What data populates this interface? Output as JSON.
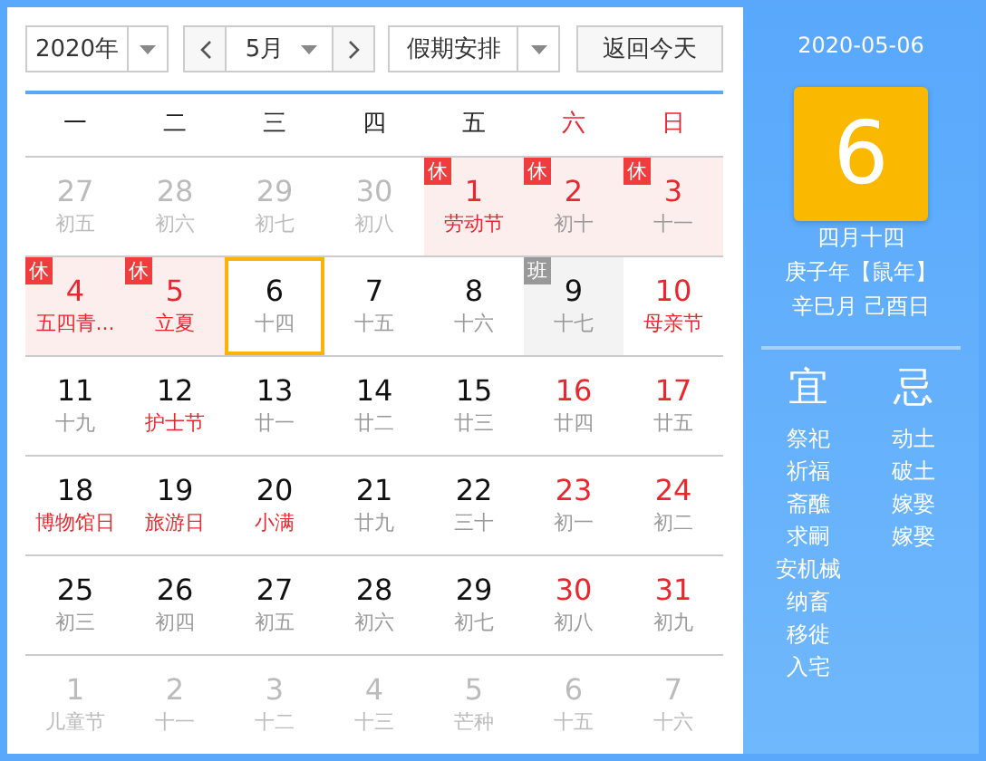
{
  "toolbar": {
    "year": "2020年",
    "month": "5月",
    "holiday": "假期安排",
    "today_button": "返回今天"
  },
  "weekdays": [
    {
      "label": "一",
      "weekend": false
    },
    {
      "label": "二",
      "weekend": false
    },
    {
      "label": "三",
      "weekend": false
    },
    {
      "label": "四",
      "weekend": false
    },
    {
      "label": "五",
      "weekend": false
    },
    {
      "label": "六",
      "weekend": true
    },
    {
      "label": "日",
      "weekend": true
    }
  ],
  "weeks": [
    [
      {
        "day": "27",
        "lunar": "初五",
        "muted": true,
        "red": false,
        "lunar_red": false,
        "selected": false
      },
      {
        "day": "28",
        "lunar": "初六",
        "muted": true,
        "red": false,
        "lunar_red": false,
        "selected": false
      },
      {
        "day": "29",
        "lunar": "初七",
        "muted": true,
        "red": false,
        "lunar_red": false,
        "selected": false
      },
      {
        "day": "30",
        "lunar": "初八",
        "muted": true,
        "red": false,
        "lunar_red": false,
        "selected": false
      },
      {
        "day": "1",
        "lunar": "劳动节",
        "muted": false,
        "red": true,
        "lunar_red": true,
        "selected": false,
        "badge": {
          "kind": "rest",
          "text": "休"
        }
      },
      {
        "day": "2",
        "lunar": "初十",
        "muted": false,
        "red": true,
        "lunar_red": false,
        "selected": false,
        "badge": {
          "kind": "rest",
          "text": "休"
        }
      },
      {
        "day": "3",
        "lunar": "十一",
        "muted": false,
        "red": true,
        "lunar_red": false,
        "selected": false,
        "badge": {
          "kind": "rest",
          "text": "休"
        }
      }
    ],
    [
      {
        "day": "4",
        "lunar": "五四青...",
        "muted": false,
        "red": true,
        "lunar_red": true,
        "selected": false,
        "badge": {
          "kind": "rest",
          "text": "休"
        }
      },
      {
        "day": "5",
        "lunar": "立夏",
        "muted": false,
        "red": true,
        "lunar_red": true,
        "selected": false,
        "badge": {
          "kind": "rest",
          "text": "休"
        }
      },
      {
        "day": "6",
        "lunar": "十四",
        "muted": false,
        "red": false,
        "lunar_red": false,
        "selected": true
      },
      {
        "day": "7",
        "lunar": "十五",
        "muted": false,
        "red": false,
        "lunar_red": false,
        "selected": false
      },
      {
        "day": "8",
        "lunar": "十六",
        "muted": false,
        "red": false,
        "lunar_red": false,
        "selected": false
      },
      {
        "day": "9",
        "lunar": "十七",
        "muted": false,
        "red": false,
        "lunar_red": false,
        "selected": false,
        "badge": {
          "kind": "work",
          "text": "班"
        }
      },
      {
        "day": "10",
        "lunar": "母亲节",
        "muted": false,
        "red": true,
        "lunar_red": true,
        "selected": false
      }
    ],
    [
      {
        "day": "11",
        "lunar": "十九",
        "muted": false,
        "red": false,
        "lunar_red": false,
        "selected": false
      },
      {
        "day": "12",
        "lunar": "护士节",
        "muted": false,
        "red": false,
        "lunar_red": true,
        "selected": false
      },
      {
        "day": "13",
        "lunar": "廿一",
        "muted": false,
        "red": false,
        "lunar_red": false,
        "selected": false
      },
      {
        "day": "14",
        "lunar": "廿二",
        "muted": false,
        "red": false,
        "lunar_red": false,
        "selected": false
      },
      {
        "day": "15",
        "lunar": "廿三",
        "muted": false,
        "red": false,
        "lunar_red": false,
        "selected": false
      },
      {
        "day": "16",
        "lunar": "廿四",
        "muted": false,
        "red": true,
        "lunar_red": false,
        "selected": false
      },
      {
        "day": "17",
        "lunar": "廿五",
        "muted": false,
        "red": true,
        "lunar_red": false,
        "selected": false
      }
    ],
    [
      {
        "day": "18",
        "lunar": "博物馆日",
        "muted": false,
        "red": false,
        "lunar_red": true,
        "selected": false
      },
      {
        "day": "19",
        "lunar": "旅游日",
        "muted": false,
        "red": false,
        "lunar_red": true,
        "selected": false
      },
      {
        "day": "20",
        "lunar": "小满",
        "muted": false,
        "red": false,
        "lunar_red": true,
        "selected": false
      },
      {
        "day": "21",
        "lunar": "廿九",
        "muted": false,
        "red": false,
        "lunar_red": false,
        "selected": false
      },
      {
        "day": "22",
        "lunar": "三十",
        "muted": false,
        "red": false,
        "lunar_red": false,
        "selected": false
      },
      {
        "day": "23",
        "lunar": "初一",
        "muted": false,
        "red": true,
        "lunar_red": false,
        "selected": false
      },
      {
        "day": "24",
        "lunar": "初二",
        "muted": false,
        "red": true,
        "lunar_red": false,
        "selected": false
      }
    ],
    [
      {
        "day": "25",
        "lunar": "初三",
        "muted": false,
        "red": false,
        "lunar_red": false,
        "selected": false
      },
      {
        "day": "26",
        "lunar": "初四",
        "muted": false,
        "red": false,
        "lunar_red": false,
        "selected": false
      },
      {
        "day": "27",
        "lunar": "初五",
        "muted": false,
        "red": false,
        "lunar_red": false,
        "selected": false
      },
      {
        "day": "28",
        "lunar": "初六",
        "muted": false,
        "red": false,
        "lunar_red": false,
        "selected": false
      },
      {
        "day": "29",
        "lunar": "初七",
        "muted": false,
        "red": false,
        "lunar_red": false,
        "selected": false
      },
      {
        "day": "30",
        "lunar": "初八",
        "muted": false,
        "red": true,
        "lunar_red": false,
        "selected": false
      },
      {
        "day": "31",
        "lunar": "初九",
        "muted": false,
        "red": true,
        "lunar_red": false,
        "selected": false
      }
    ],
    [
      {
        "day": "1",
        "lunar": "儿童节",
        "muted": true,
        "red": false,
        "lunar_red": false,
        "selected": false
      },
      {
        "day": "2",
        "lunar": "十一",
        "muted": true,
        "red": false,
        "lunar_red": false,
        "selected": false
      },
      {
        "day": "3",
        "lunar": "十二",
        "muted": true,
        "red": false,
        "lunar_red": false,
        "selected": false
      },
      {
        "day": "4",
        "lunar": "十三",
        "muted": true,
        "red": false,
        "lunar_red": false,
        "selected": false
      },
      {
        "day": "5",
        "lunar": "芒种",
        "muted": true,
        "red": false,
        "lunar_red": false,
        "selected": false
      },
      {
        "day": "6",
        "lunar": "十五",
        "muted": true,
        "red": false,
        "lunar_red": false,
        "selected": false
      },
      {
        "day": "7",
        "lunar": "十六",
        "muted": true,
        "red": false,
        "lunar_red": false,
        "selected": false
      }
    ]
  ],
  "detail": {
    "date": "2020-05-06",
    "day": "6",
    "lunar_date": "四月十四",
    "year": "庚子年【鼠年】",
    "month_day": "辛巳月 己酉日",
    "good": {
      "title": "宜",
      "items": [
        "祭祀",
        "祈福",
        "斋醮",
        "求嗣",
        "安机械",
        "纳畜",
        "移徙",
        "入宅"
      ]
    },
    "bad": {
      "title": "忌",
      "items": [
        "动土",
        "破土",
        "嫁娶",
        "嫁娶"
      ]
    }
  }
}
